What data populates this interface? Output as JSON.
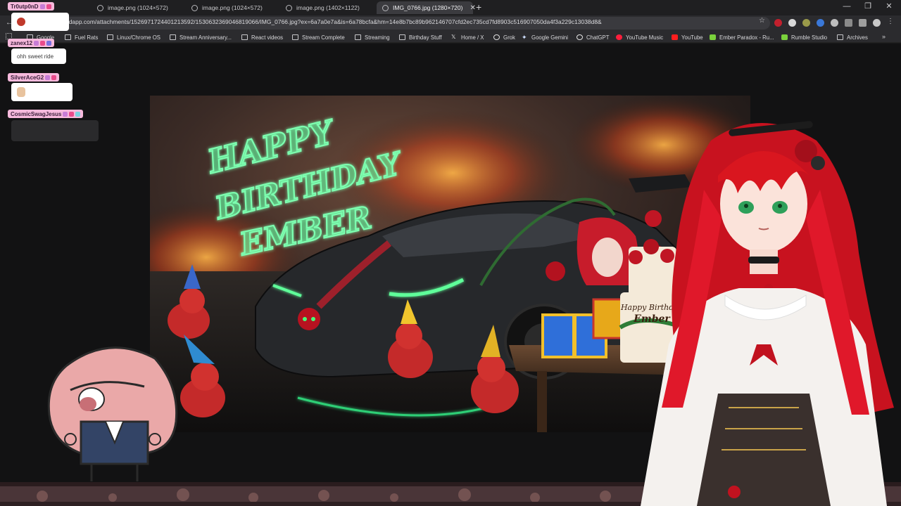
{
  "browser": {
    "tabs": [
      {
        "label": "image.png (1024×572)",
        "active": false
      },
      {
        "label": "image.png (1024×572)",
        "active": false
      },
      {
        "label": "image.png (1402×1122)",
        "active": false
      },
      {
        "label": "IMG_0766.jpg (1280×720)",
        "active": true
      }
    ],
    "new_tab_icon": "plus-icon",
    "window_controls": [
      "minimize-icon",
      "restore-icon",
      "close-icon"
    ],
    "url": "n.discordapp.com/attachments/1526971724401213592/1530632369046819066/IMG_0766.jpg?ex=6a7a0e7a&is=6a78bcfa&hm=14e8b7bc89b962146707cfd2ec735cd7fd8903c516907050da4f3a229c13038d8&",
    "bookmark_star_icon": "star-icon",
    "bookmarks": [
      {
        "label": "Google",
        "icon": "folder-icon"
      },
      {
        "label": "Fuel Rats",
        "icon": "folder-icon"
      },
      {
        "label": "Linux/Chrome OS",
        "icon": "folder-icon"
      },
      {
        "label": "Stream Anniversary...",
        "icon": "folder-icon"
      },
      {
        "label": "React videos",
        "icon": "folder-icon"
      },
      {
        "label": "Stream Complete",
        "icon": "folder-icon"
      },
      {
        "label": "Streaming",
        "icon": "folder-icon"
      },
      {
        "label": "Birthday Stuff",
        "icon": "folder-icon"
      },
      {
        "label": "Home / X",
        "icon": "x-logo-icon"
      },
      {
        "label": "Grok",
        "icon": "grok-icon"
      },
      {
        "label": "Google Gemini",
        "icon": "gemini-icon"
      },
      {
        "label": "ChatGPT",
        "icon": "chatgpt-icon"
      },
      {
        "label": "YouTube Music",
        "icon": "youtube-music-icon"
      },
      {
        "label": "YouTube",
        "icon": "youtube-icon"
      },
      {
        "label": "Ember Paradox - Ru...",
        "icon": "rumble-icon"
      },
      {
        "label": "Rumble Studio",
        "icon": "rumble-icon"
      },
      {
        "label": "Archives",
        "icon": "folder-icon"
      }
    ],
    "bookmarks_more_icon": "chevron-double-right-icon"
  },
  "artwork": {
    "lettering": [
      "HAPPY",
      "BIRTHDAY",
      "EMBER"
    ],
    "cake_lettering": [
      "Happy Birthday",
      "Ember"
    ]
  },
  "chat": [
    {
      "user": "Tr0utp0nD",
      "message": "",
      "name_color": "#f6b9dc"
    },
    {
      "user": "zanex12",
      "message": "ohh sweet ride",
      "name_color": "#f6b9dc"
    },
    {
      "user": "SilverAceG2",
      "message": "",
      "name_color": "#f6b9dc"
    },
    {
      "user": "CosmicSwagJesus",
      "message": "",
      "name_color": "#f6b9dc"
    }
  ],
  "colors": {
    "chrome_dark": "#1f1f21",
    "toolbar": "#2b2b2e",
    "neon_green": "#7dffb0",
    "ember_red": "#d01c2a"
  }
}
